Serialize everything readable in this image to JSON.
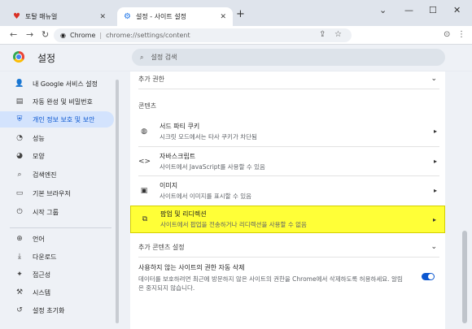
{
  "browser": {
    "tabs": [
      {
        "title": "토탈 매뉴얼",
        "icon": "heart-icon"
      },
      {
        "title": "설정 - 사이트 설정",
        "icon": "gear-icon"
      }
    ],
    "new_tab_label": "+",
    "window_controls": [
      "⌄",
      "—",
      "☐",
      "✕"
    ],
    "omnibox": {
      "chip": "Chrome",
      "separator": "|",
      "url": "chrome://settings/content"
    }
  },
  "app": {
    "title": "설정",
    "search_placeholder": "설정 검색"
  },
  "sidebar": {
    "items": [
      {
        "label": "내 Google 서비스 설정",
        "icon": "person-icon",
        "glyph": "👤"
      },
      {
        "label": "자동 완성 및 비밀번호",
        "icon": "clipboard-icon",
        "glyph": "▤"
      },
      {
        "label": "개인 정보 보호 및 보안",
        "icon": "shield-icon",
        "glyph": "⛨"
      },
      {
        "label": "성능",
        "icon": "speedometer-icon",
        "glyph": "◔"
      },
      {
        "label": "모양",
        "icon": "palette-icon",
        "glyph": "◕"
      },
      {
        "label": "검색엔진",
        "icon": "search-icon",
        "glyph": "⌕"
      },
      {
        "label": "기본 브라우저",
        "icon": "browser-icon",
        "glyph": "▭"
      },
      {
        "label": "시작 그룹",
        "icon": "power-icon",
        "glyph": "⏻"
      },
      {
        "label": "언어",
        "icon": "globe-icon",
        "glyph": "⊕"
      },
      {
        "label": "다운로드",
        "icon": "download-icon",
        "glyph": "⤓"
      },
      {
        "label": "접근성",
        "icon": "accessibility-icon",
        "glyph": "✦"
      },
      {
        "label": "시스템",
        "icon": "wrench-icon",
        "glyph": "⚒"
      },
      {
        "label": "설정 초기화",
        "icon": "reset-icon",
        "glyph": "↺"
      }
    ]
  },
  "content": {
    "additional_permissions": "추가 권한",
    "content_heading": "콘텐츠",
    "rows": [
      {
        "title": "서드 파티 쿠키",
        "subtitle": "시크릿 모드에서는 타사 쿠키가 차단됨",
        "icon": "cookie-icon",
        "glyph": "◍"
      },
      {
        "title": "자바스크립트",
        "subtitle": "사이트에서 JavaScript를 사용할 수 있음",
        "icon": "code-icon",
        "glyph": "<>"
      },
      {
        "title": "이미지",
        "subtitle": "사이트에서 이미지를 표시할 수 있음",
        "icon": "image-icon",
        "glyph": "▣"
      },
      {
        "title": "팝업 및 리디렉션",
        "subtitle": "사이트에서 팝업을 전송하거나 리디렉션을 사용할 수 없음",
        "icon": "external-link-icon",
        "glyph": "⧉"
      }
    ],
    "additional_content_settings": "추가 콘텐츠 설정",
    "auto_remove": {
      "title": "사용하지 않는 사이트의 권한 자동 삭제",
      "description_line1": "데이터를 보호하려면 최근에 방문하지 않은 사이트의 권한을 Chrome에서 삭제하도록 허용하세요. 알림",
      "description_line2": "은 중지되지 않습니다.",
      "enabled": true
    }
  },
  "colors": {
    "accent": "#0b57d0",
    "highlight": "#ffff37"
  }
}
